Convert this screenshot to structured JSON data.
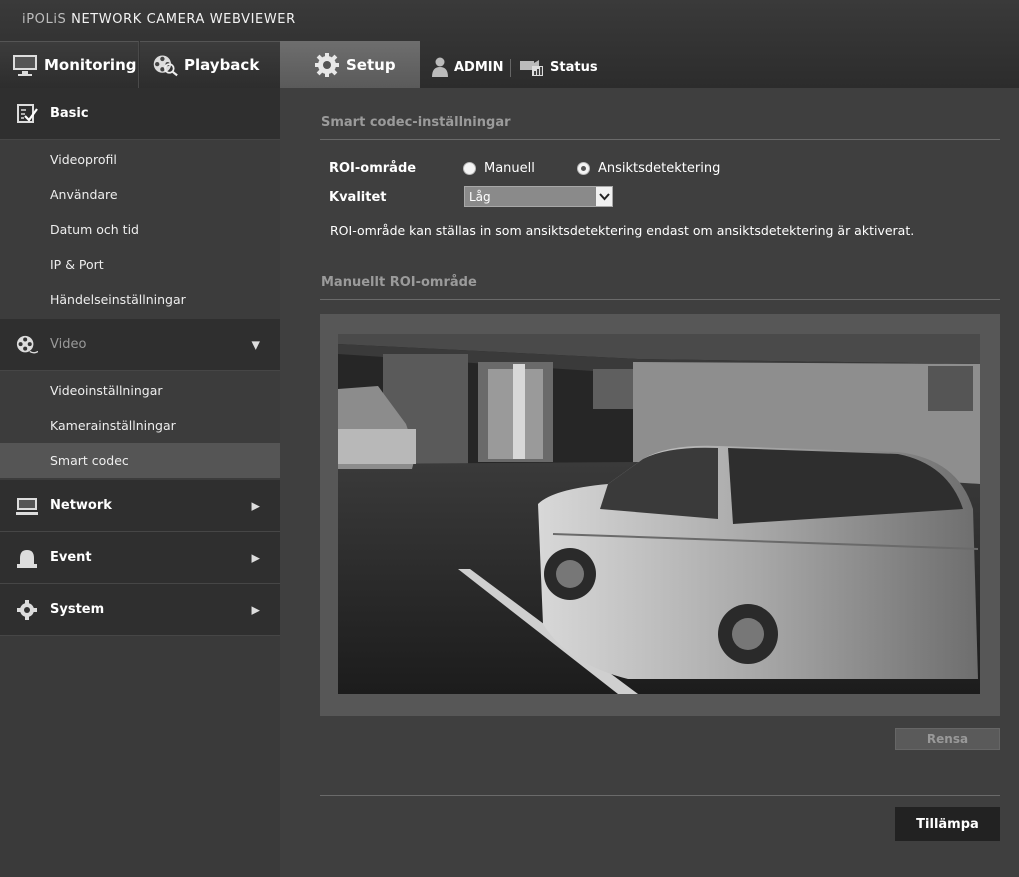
{
  "header": {
    "brand_prefix": "iPOLiS",
    "brand_title": "NETWORK CAMERA WEBVIEWER",
    "tabs": [
      {
        "label": "Monitoring"
      },
      {
        "label": "Playback"
      },
      {
        "label": "Setup"
      }
    ],
    "user_label": "ADMIN",
    "status_label": "Status"
  },
  "sidebar": {
    "basic": {
      "label": "Basic",
      "items": [
        "Videoprofil",
        "Användare",
        "Datum och tid",
        "IP & Port",
        "Händelseinställningar"
      ]
    },
    "video": {
      "label": "Video",
      "items": [
        "Videoinställningar",
        "Kamerainställningar",
        "Smart codec"
      ],
      "active_item": "Smart codec"
    },
    "network": {
      "label": "Network"
    },
    "event": {
      "label": "Event"
    },
    "system": {
      "label": "System"
    }
  },
  "main": {
    "section_title": "Smart codec-inställningar",
    "roi_label": "ROI-område",
    "roi_options": [
      {
        "label": "Manuell",
        "checked": false
      },
      {
        "label": "Ansiktsdetektering",
        "checked": true
      }
    ],
    "quality_label": "Kvalitet",
    "quality_value": "Låg",
    "info_text": "ROI-område kan ställas in som ansiktsdetektering endast om ansiktsdetektering är aktiverat.",
    "manual_roi_title": "Manuellt ROI-område",
    "clear_button": "Rensa",
    "apply_button": "Tillämpa"
  },
  "colors": {
    "header_bg": "#2c2c2c",
    "sidebar_bg": "#3a3a3a",
    "main_bg": "#3f3f3f",
    "active_tab": "#666666",
    "active_item": "#555555"
  }
}
